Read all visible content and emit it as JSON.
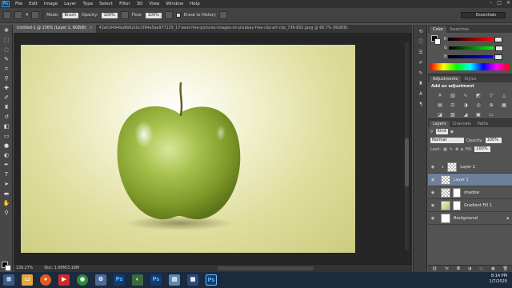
{
  "app": {
    "logo": "Ps",
    "menu": [
      "File",
      "Edit",
      "Image",
      "Layer",
      "Type",
      "Select",
      "Filter",
      "3D",
      "View",
      "Window",
      "Help"
    ],
    "window_buttons": [
      "–",
      "□",
      "✕"
    ]
  },
  "options_bar": {
    "brush_size": "4",
    "mode_label": "Mode:",
    "mode_value": "Brush",
    "opacity_label": "Opacity:",
    "opacity_value": "100%",
    "flow_label": "Flow:",
    "flow_value": "100%",
    "erase_history_label": "Erase to History",
    "workspace": "Essentials"
  },
  "document": {
    "tabs": [
      {
        "label": "Untitled-1 @ 136% (Layer 1, RGB/8)",
        "active": true
      },
      {
        "label": "43efc9494ba8b62cbc1f94e5ae977139_17-best-free-pictures-images-on-pixabay-free-clip-art-clip_736-802.jpeg @ 66.7% (RGB/8)",
        "active": false
      }
    ],
    "zoom": "136.27%",
    "doc_size": "Doc: 1.00M/3.18M"
  },
  "color_panel": {
    "tabs": [
      "Color",
      "Swatches"
    ],
    "channels": [
      "R",
      "G",
      "B"
    ]
  },
  "adjustments": {
    "tabs": [
      "Adjustments",
      "Styles"
    ],
    "title": "Add an adjustment",
    "icons": [
      "brightness-icon",
      "levels-icon",
      "curves-icon",
      "exposure-icon",
      "vibrance-icon",
      "triangle-icon",
      "hue-icon",
      "color-balance-icon",
      "bw-icon",
      "photo-filter-icon",
      "channel-mixer-icon",
      "grid-icon",
      "invert-icon",
      "posterize-icon",
      "threshold-icon",
      "selective-color-icon",
      "gradient-map-icon"
    ]
  },
  "layers_panel": {
    "tabs": [
      "Layers",
      "Channels",
      "Paths"
    ],
    "kind_filter": "Kind",
    "blend_mode": "Normal",
    "opacity_label": "Opacity:",
    "opacity_value": "100%",
    "lock_label": "Lock:",
    "fill_label": "Fill:",
    "fill_value": "100%",
    "layers": [
      {
        "name": "Layer 2",
        "selected": false,
        "italic": false
      },
      {
        "name": "Layer 1",
        "selected": true,
        "italic": false
      },
      {
        "name": "shadow",
        "selected": false,
        "italic": false
      },
      {
        "name": "Gradient Fill 1",
        "selected": false,
        "italic": false
      },
      {
        "name": "Background",
        "selected": false,
        "italic": true
      }
    ]
  },
  "taskbar": {
    "time": "8:14 PM",
    "date": "1/7/2020"
  }
}
